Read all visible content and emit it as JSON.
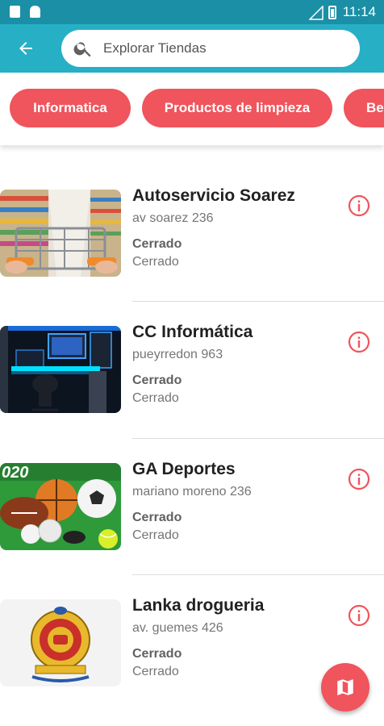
{
  "status_bar": {
    "time": "11:14"
  },
  "search": {
    "placeholder": "Explorar Tiendas"
  },
  "categories": [
    "Informatica",
    "Productos de limpieza",
    "Be"
  ],
  "stores": [
    {
      "name": "Autoservicio Soarez",
      "address": "av soarez 236",
      "status": "Cerrado",
      "hours": "Cerrado"
    },
    {
      "name": "CC Informática",
      "address": "pueyrredon 963",
      "status": "Cerrado",
      "hours": "Cerrado"
    },
    {
      "name": "GA Deportes",
      "address": "mariano moreno 236",
      "status": "Cerrado",
      "hours": "Cerrado"
    },
    {
      "name": "Lanka drogueria",
      "address": "av. guemes 426",
      "status": "Cerrado",
      "hours": "Cerrado"
    }
  ],
  "images": {
    "sports_banner_text": "020"
  },
  "icons": {
    "back": "arrow-left-icon",
    "search": "search-icon",
    "info": "info-circle-icon",
    "map": "map-icon"
  },
  "colors": {
    "app_bar": "#27afc6",
    "status_bar": "#1b8fa6",
    "accent": "#f0545c"
  }
}
